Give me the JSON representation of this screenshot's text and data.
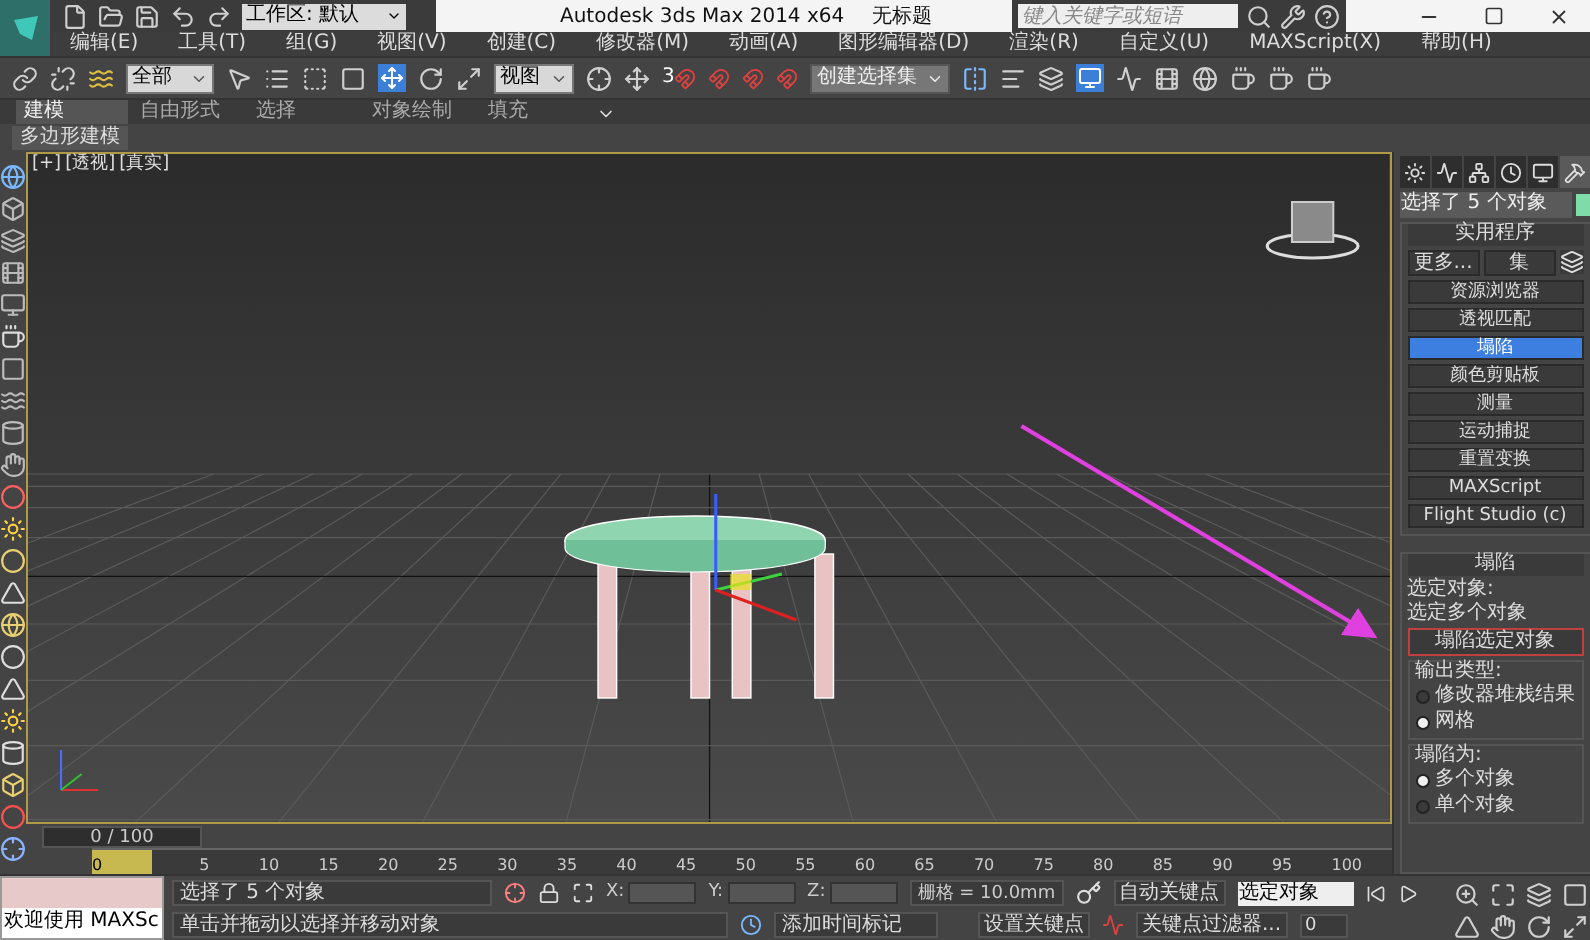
{
  "window": {
    "title": "Autodesk 3ds Max  2014 x64",
    "document": "无标题",
    "workspace": "工作区: 默认",
    "search": {
      "placeholder": "键入关键字或短语"
    }
  },
  "menu": [
    "编辑(E)",
    "工具(T)",
    "组(G)",
    "视图(V)",
    "创建(C)",
    "修改器(M)",
    "动画(A)",
    "图形编辑器(D)",
    "渲染(R)",
    "自定义(U)",
    "MAXScript(X)",
    "帮助(H)"
  ],
  "toolbar": {
    "filter": "全部",
    "coord": "视图",
    "snap": "3",
    "selection_set": "创建选择集"
  },
  "ribbon": {
    "tabs": [
      {
        "label": "建模",
        "selected": true
      },
      {
        "label": "自由形式",
        "selected": false
      },
      {
        "label": "选择",
        "selected": false
      },
      {
        "label": "对象绘制",
        "selected": false
      },
      {
        "label": "填充",
        "selected": false
      }
    ],
    "panel": "多边形建模"
  },
  "viewport": {
    "labels": [
      "[+]",
      "[透视]",
      "[真实]"
    ]
  },
  "command_panel": {
    "tabs": [
      {
        "kind": "create",
        "selected": false
      },
      {
        "kind": "modify",
        "selected": false
      },
      {
        "kind": "hierarchy",
        "selected": false
      },
      {
        "kind": "motion",
        "selected": false
      },
      {
        "kind": "display",
        "selected": false
      },
      {
        "kind": "utilities",
        "selected": true
      }
    ],
    "selection": "选择了 5 个对象",
    "color": "#7fdca8",
    "utilities": {
      "title": "实用程序",
      "more": "更多...",
      "sets": "集",
      "items": [
        {
          "label": "资源浏览器",
          "selected": false
        },
        {
          "label": "透视匹配",
          "selected": false
        },
        {
          "label": "塌陷",
          "selected": true
        },
        {
          "label": "颜色剪贴板",
          "selected": false
        },
        {
          "label": "测量",
          "selected": false
        },
        {
          "label": "运动捕捉",
          "selected": false
        },
        {
          "label": "重置变换",
          "selected": false
        },
        {
          "label": "MAXScript",
          "selected": false
        },
        {
          "label": "Flight Studio (c)",
          "selected": false
        }
      ]
    },
    "collapse": {
      "title": "塌陷",
      "selected_label": "选定对象:",
      "selected_value": "选定多个对象",
      "button": "塌陷选定对象",
      "output_label": "输出类型:",
      "output": [
        {
          "label": "修改器堆栈结果",
          "selected": false
        },
        {
          "label": "网格",
          "selected": true
        }
      ],
      "collapse_label": "塌陷为:",
      "collapse_to": [
        {
          "label": "多个对象",
          "selected": true
        },
        {
          "label": "单个对象",
          "selected": false
        }
      ]
    }
  },
  "timeline": {
    "position": "0 / 100",
    "ticks": [
      "0",
      "5",
      "10",
      "15",
      "20",
      "25",
      "30",
      "35",
      "40",
      "45",
      "50",
      "55",
      "60",
      "65",
      "70",
      "75",
      "80",
      "85",
      "90",
      "95",
      "100"
    ]
  },
  "status": {
    "welcome": "欢迎使用 MAXSc",
    "selection_info": "选择了 5 个对象",
    "prompt": "单击并拖动以选择并移动对象",
    "x_label": "X:",
    "y_label": "Y:",
    "z_label": "Z:",
    "grid": "栅格 = 10.0mm",
    "add_time_tag": "添加时间标记",
    "auto_key": "自动关键点",
    "set_key": "设置关键点",
    "key_mode": "选定对象",
    "key_filters": "关键点过滤器...",
    "frame": "0"
  }
}
